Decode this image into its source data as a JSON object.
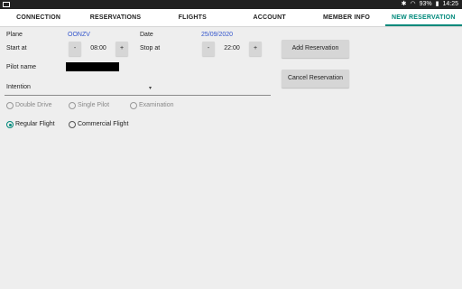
{
  "status": {
    "battery": "93%",
    "time": "14:25"
  },
  "tabs": [
    {
      "label": "CONNECTION"
    },
    {
      "label": "RESERVATIONS"
    },
    {
      "label": "FLIGHTS"
    },
    {
      "label": "ACCOUNT"
    },
    {
      "label": "MEMBER INFO"
    },
    {
      "label": "NEW RESERVATION",
      "active": true
    }
  ],
  "form": {
    "plane_label": "Plane",
    "plane_value": "OONZV",
    "date_label": "Date",
    "date_value": "25/09/2020",
    "start_label": "Start at",
    "start_time": "08:00",
    "stop_label": "Stop at",
    "stop_time": "22:00",
    "minus": "-",
    "plus": "+",
    "pilot_label": "Pilot name",
    "intention_label": "Intention",
    "add_button": "Add Reservation",
    "cancel_button": "Cancel Reservation",
    "radio_group_1": [
      "Double Drive",
      "Single Pilot",
      "Examination"
    ],
    "radio_group_2": [
      "Regular Flight",
      "Commercial Flight"
    ],
    "selected_flight_type": "Regular Flight"
  },
  "colors": {
    "accent": "#00897b",
    "link_blue": "#3355cc",
    "status_bar": "#212121"
  }
}
